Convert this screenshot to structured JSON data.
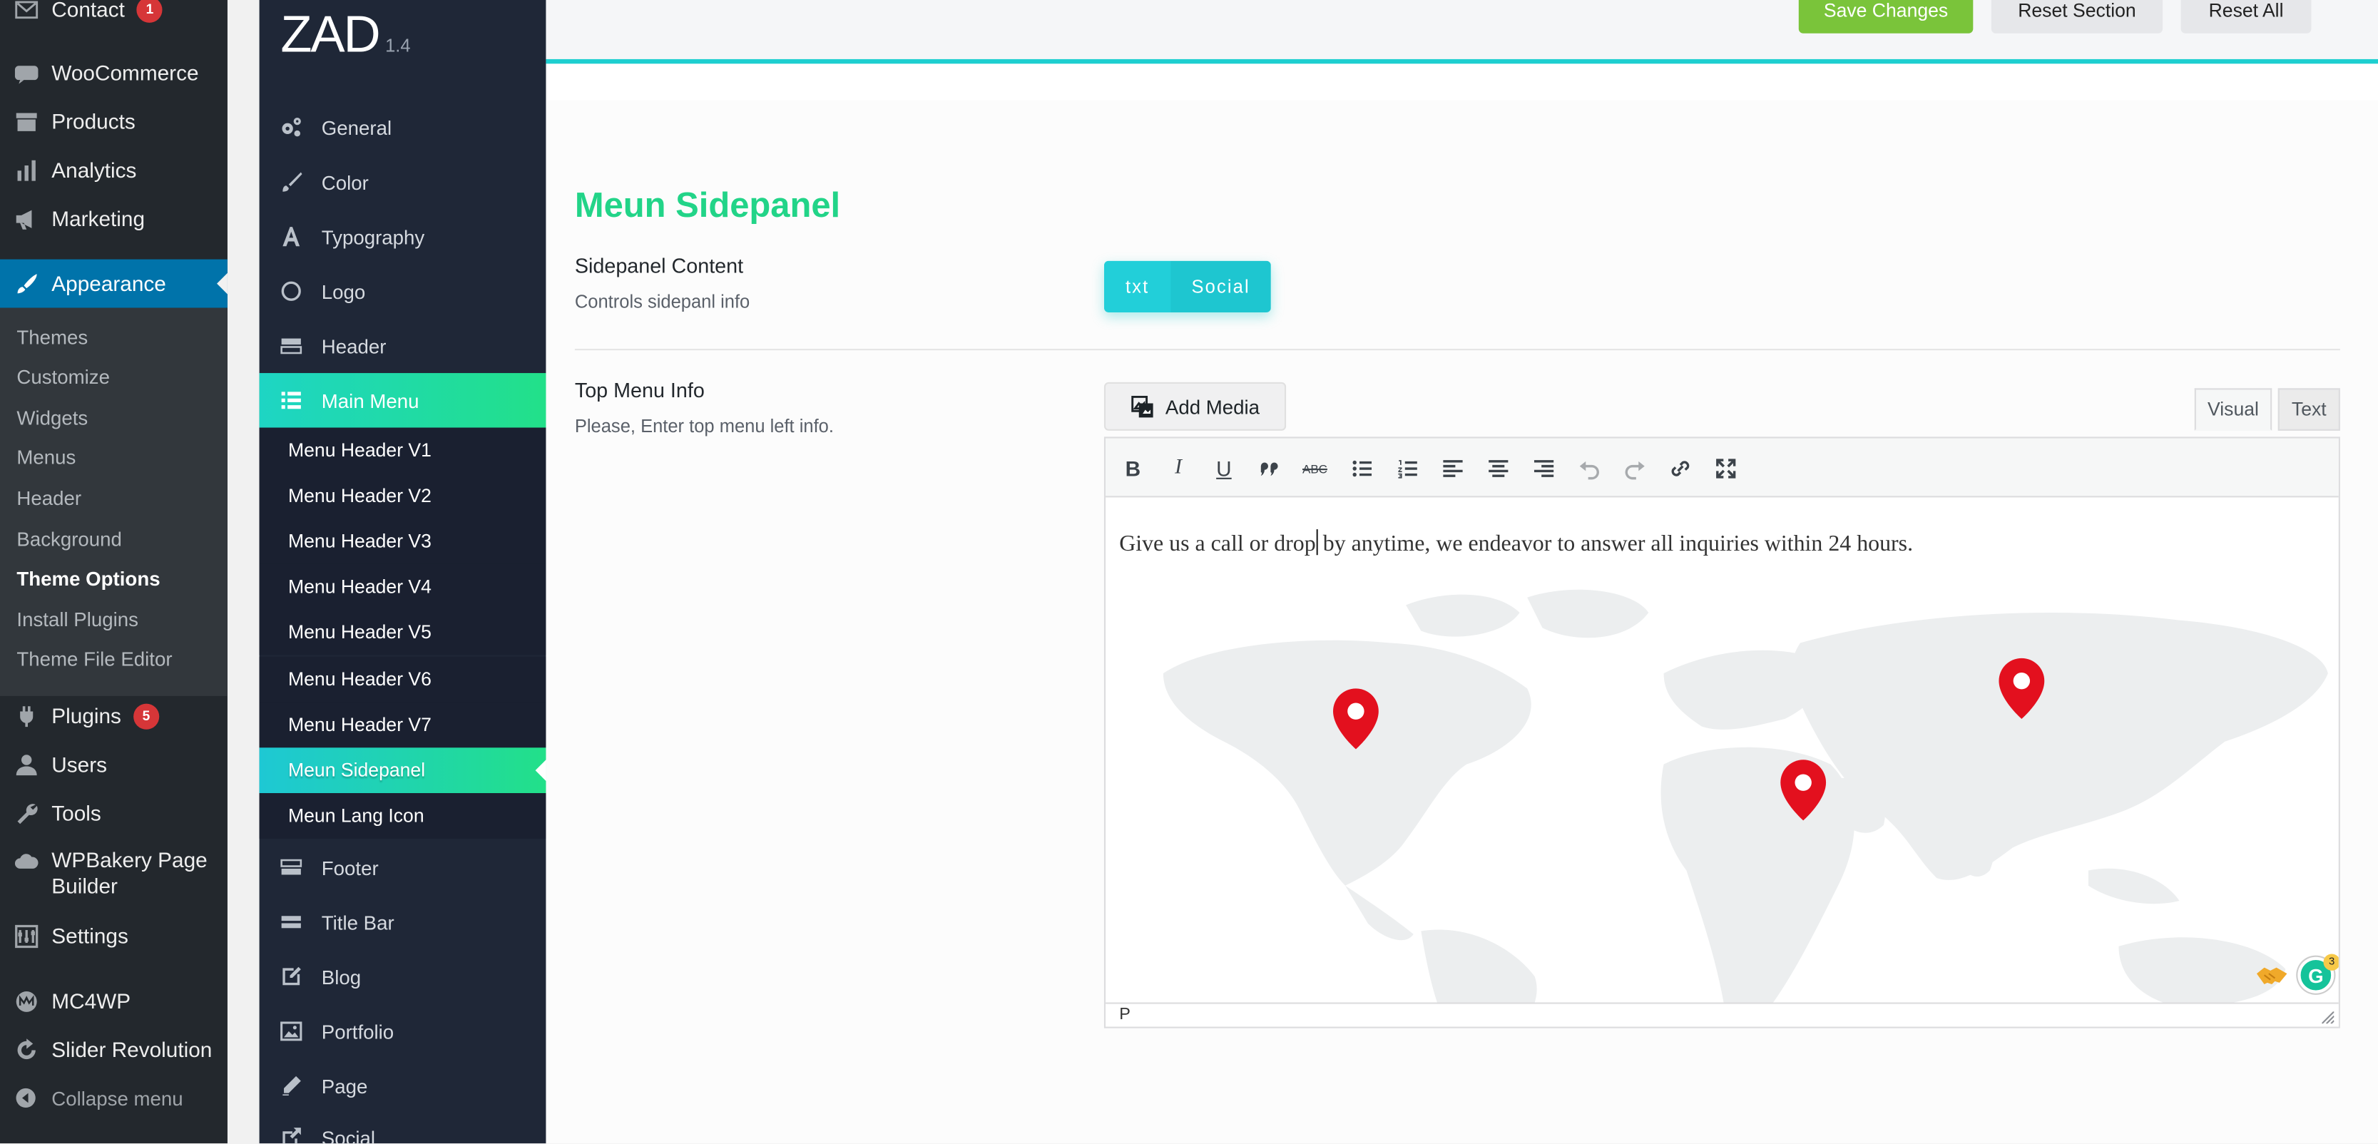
{
  "wp_menu": {
    "contact": {
      "label": "Contact",
      "badge": "1"
    },
    "woocommerce": "WooCommerce",
    "products": "Products",
    "analytics": "Analytics",
    "marketing": "Marketing",
    "appearance": "Appearance",
    "appearance_sub": [
      "Themes",
      "Customize",
      "Widgets",
      "Menus",
      "Header",
      "Background",
      "Theme Options",
      "Install Plugins",
      "Theme File Editor"
    ],
    "plugins": {
      "label": "Plugins",
      "badge": "5"
    },
    "users": "Users",
    "tools": "Tools",
    "wpbakery": "WPBakery Page Builder",
    "settings": "Settings",
    "mc4wp": "MC4WP",
    "slider": "Slider Revolution",
    "collapse": "Collapse menu"
  },
  "options_panel": {
    "logo": "ZAD",
    "version": "1.4",
    "items": [
      "General",
      "Color",
      "Typography",
      "Logo",
      "Header",
      "Main Menu"
    ],
    "sub_items": [
      "Menu Header V1",
      "Menu Header V2",
      "Menu Header V3",
      "Menu Header V4",
      "Menu Header V5",
      "Menu Header V6",
      "Menu Header V7",
      "Meun Sidepanel",
      "Meun Lang Icon"
    ],
    "items_after": [
      "Footer",
      "Title Bar",
      "Blog",
      "Portfolio",
      "Page",
      "Social"
    ]
  },
  "top_buttons": {
    "save": "Save Changes",
    "reset_section": "Reset Section",
    "reset_all": "Reset All"
  },
  "section": {
    "title": "Meun Sidepanel",
    "sidepanel_content": {
      "label": "Sidepanel Content",
      "desc": "Controls sidepanl info",
      "options": [
        "txt",
        "Social"
      ]
    },
    "top_menu_info": {
      "label": "Top Menu Info",
      "desc": "Please, Enter top menu left info."
    }
  },
  "editor": {
    "add_media": "Add Media",
    "tabs": {
      "visual": "Visual",
      "text": "Text"
    },
    "toolbar": {
      "bold": "B",
      "italic": "I",
      "underline": "U",
      "strike": "ABC"
    },
    "text_before_caret": "Give us a call or drop",
    "text_after_caret": " by anytime, we endeavor to answer all inquiries within 24 hours.",
    "status_path": "P",
    "grammarly_logo": "G",
    "grammarly_count": "3"
  },
  "colors": {
    "wp_sidebar": "#23282d",
    "wp_active": "#0073aa",
    "options_panel": "#1f2737",
    "accent_gradient_start": "#1ed5c4",
    "accent_gradient_end": "#22e089",
    "section_title": "#22d488",
    "save_button": "#7ac43a",
    "map_pin": "#e3101e"
  }
}
